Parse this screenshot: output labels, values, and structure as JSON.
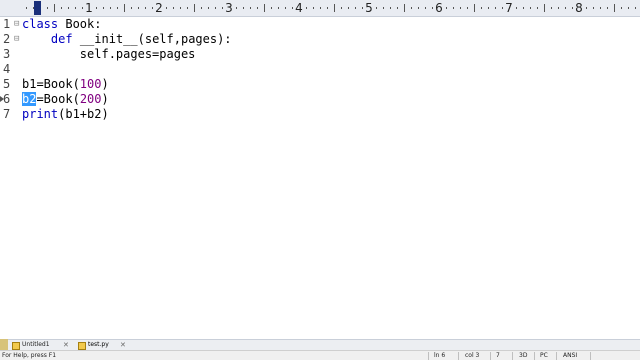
{
  "ruler": {
    "numbers": [
      "1",
      "2",
      "3",
      "4",
      "5",
      "6",
      "7",
      "8"
    ]
  },
  "gutter": {
    "line_numbers": [
      "1",
      "2",
      "3",
      "4",
      "5",
      "6",
      "7"
    ]
  },
  "code": {
    "line1": {
      "kw": "class",
      "rest": " Book:"
    },
    "line2": {
      "indent": "    ",
      "kw": "def",
      "rest": " __init__(self,pages):"
    },
    "line3": {
      "text": "        self.pages=pages"
    },
    "line4": {
      "text": ""
    },
    "line5": {
      "pre": "b1=Book(",
      "num": "100",
      "post": ")"
    },
    "line6": {
      "sel": "b2",
      "pre": "=Book(",
      "num": "200",
      "post": ")"
    },
    "line7": {
      "kw": "print",
      "rest": "(b1+b2)"
    }
  },
  "tabs": [
    {
      "label": "Untitled1",
      "close": "✕"
    },
    {
      "label": "test.py",
      "close": "✕"
    }
  ],
  "status": {
    "help": "For Help, press F1",
    "ln": "ln 6",
    "col": "col 3",
    "pos": "7",
    "mode3d": "3D",
    "pc": "PC",
    "encoding": "ANSI"
  },
  "colors": {
    "keyword": "#0000c0",
    "number": "#800080",
    "selection": "#3399ff"
  }
}
